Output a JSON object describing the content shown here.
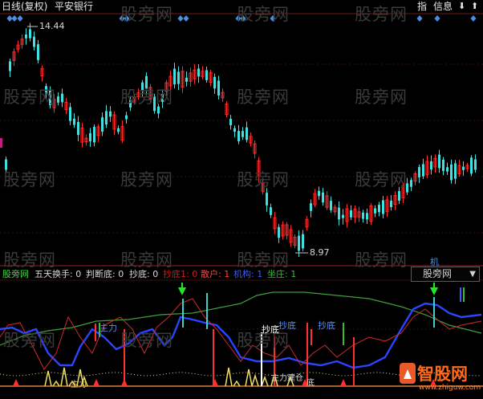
{
  "header": {
    "period": "日线(复权)",
    "stock": "平安银行",
    "zhi": "指",
    "xinxi": "信息",
    "down_arrow": "⬇",
    "up_arrow": "⬆"
  },
  "watermark": "股旁网",
  "price_labels": {
    "high": "14.44",
    "low": "8.97"
  },
  "subchart": {
    "selector_label": "股旁网",
    "selector_icon": "triangle-down-icon",
    "legend": [
      {
        "text": "股旁网",
        "color": "#3cdc3c"
      },
      {
        "text": "五天换手: 0",
        "color": "#d8d8d8"
      },
      {
        "text": "判断底: 0",
        "color": "#d8d8d8"
      },
      {
        "text": "抄底: 0",
        "color": "#d8d8d8"
      },
      {
        "text": "抄底1: 0",
        "color": "#c81e1e"
      },
      {
        "text": "散户: 1",
        "color": "#ff4040"
      },
      {
        "text": "机构: 1",
        "color": "#3c5aff"
      },
      {
        "text": "坐庄: 1",
        "color": "#3cb43c"
      }
    ],
    "annotations": [
      {
        "text": "抄底",
        "color": "#ffffff"
      },
      {
        "text": "抄底",
        "color": "#5a8cff"
      },
      {
        "text": "抄底",
        "color": "#5a8cff"
      },
      {
        "text": "主力建仓",
        "color": "#d8d8d8"
      },
      {
        "text": "底",
        "color": "#d8d8d8"
      },
      {
        "text": "主力",
        "color": "#5a8cff"
      },
      {
        "text": "主力",
        "color": "#e6c864"
      }
    ]
  },
  "brand_logo": {
    "text": "智股网",
    "url": "www.zhiguw.com"
  },
  "marker_ji": "机",
  "colors": {
    "up": "#ff2a2a",
    "down": "#40e0e0",
    "axis": "#7a1f1f",
    "diamond": "#4a90e0"
  }
}
